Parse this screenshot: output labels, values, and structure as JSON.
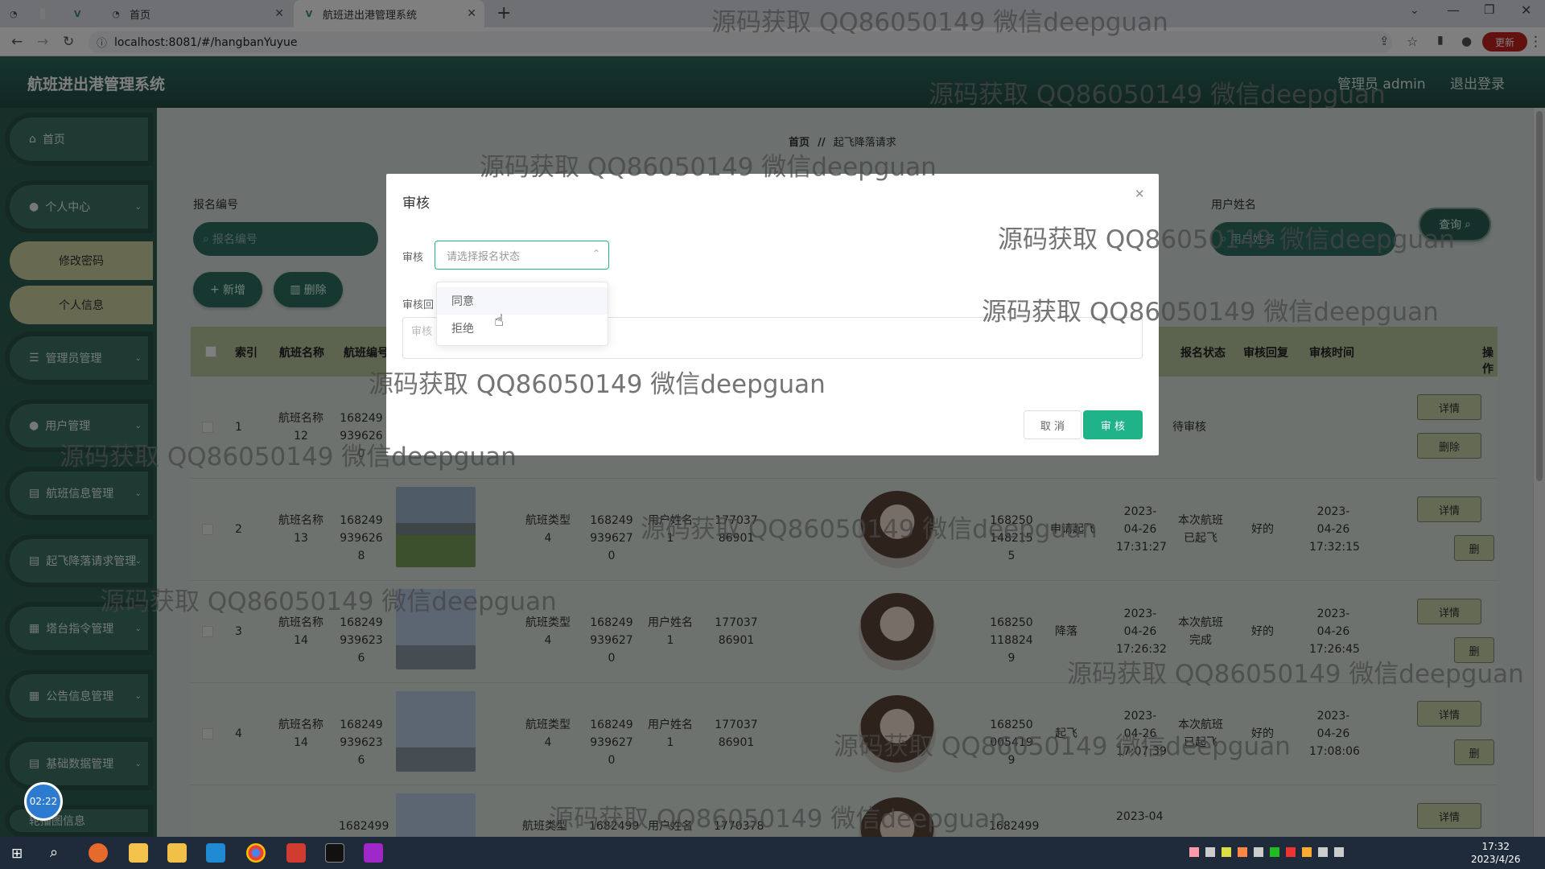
{
  "browser": {
    "tabs": [
      {
        "label": ""
      },
      {
        "label": ""
      },
      {
        "label": "首页"
      },
      {
        "label": "航班进出港管理系统"
      }
    ],
    "url": "localhost:8081/#/hangbanYuyue",
    "update_label": "更新"
  },
  "header": {
    "title": "航班进出港管理系统",
    "user": "管理员 admin",
    "logout": "退出登录"
  },
  "sidebar": {
    "items": [
      {
        "label": "首页"
      },
      {
        "label": "个人中心"
      },
      {
        "label": "修改密码"
      },
      {
        "label": "个人信息"
      },
      {
        "label": "管理员管理"
      },
      {
        "label": "用户管理"
      },
      {
        "label": "航班信息管理"
      },
      {
        "label": "起飞降落请求管理"
      },
      {
        "label": "塔台指令管理"
      },
      {
        "label": "公告信息管理"
      },
      {
        "label": "基础数据管理"
      },
      {
        "label": "轮播图信息"
      }
    ]
  },
  "breadcrumb": {
    "home": "首页",
    "sep": "//",
    "current": "起飞降落请求"
  },
  "search": {
    "label1": "报名编号",
    "placeholder1": "报名编号",
    "label2": "用户姓名",
    "placeholder2": "用户姓名",
    "query": "查询"
  },
  "toolbar": {
    "add": "新增",
    "delete": "删除"
  },
  "table": {
    "headers": [
      "索引",
      "航班名称",
      "航班编号",
      "",
      "",
      "",
      "",
      "",
      "",
      "报名状态",
      "审核回复",
      "审核时间",
      "操作"
    ],
    "rows": [
      {
        "index": "1",
        "name": "航班名称12",
        "code": "1682499396260",
        "h": "",
        "uid": "",
        "uname": "",
        "phone": "",
        "hid": "",
        "type": "",
        "status": "待审核",
        "reply": "",
        "time": ""
      },
      {
        "index": "2",
        "name": "航班名称13",
        "code": "1682499396268",
        "type1": "航班类型4",
        "n1": "1682499396270",
        "uname": "用户姓名1",
        "phone": "17703786901",
        "rid": "1682501482155",
        "req": "申请起飞",
        "status": "本次航班已起飞",
        "reply": "好的",
        "time": "2023-04-26 17:32:15",
        "rtime": "2023-04-26 17:31:27"
      },
      {
        "index": "3",
        "name": "航班名称14",
        "code": "1682499396236",
        "type1": "航班类型4",
        "n1": "1682499396270",
        "uname": "用户姓名1",
        "phone": "17703786901",
        "rid": "1682501188249",
        "req": "降落",
        "status": "本次航班完成",
        "reply": "好的",
        "time": "2023-04-26 17:26:45",
        "rtime": "2023-04-26 17:26:32"
      },
      {
        "index": "4",
        "name": "航班名称14",
        "code": "1682499396236",
        "type1": "航班类型4",
        "n1": "1682499396270",
        "uname": "用户姓名1",
        "phone": "17703786901",
        "rid": "1682500054199",
        "req": "起飞",
        "status": "本次航班已起飞",
        "reply": "好的",
        "time": "2023-04-26 17:08:06",
        "rtime": "2023-04-26 17:07:39"
      },
      {
        "index": "",
        "name": "",
        "code": "1682499",
        "type1": "航班类型",
        "n1": "1682499",
        "uname": "用户姓名",
        "phone": "1770378",
        "rid": "1682499",
        "req": "",
        "status": "",
        "reply": "",
        "time": "",
        "rtime": "2023-04"
      }
    ],
    "detail": "详情",
    "del": "删除",
    "del_short": "删"
  },
  "dialog": {
    "title": "审核",
    "field_label": "审核",
    "select_placeholder": "请选择报名状态",
    "options": [
      "同意",
      "拒绝"
    ],
    "reply_label": "审核回",
    "reply_placeholder": "审核",
    "cancel": "取 消",
    "confirm": "审 核"
  },
  "watermark": "源码获取 QQ86050149 微信deepguan",
  "timer": "02:22",
  "clock": {
    "time": "17:32",
    "date": "2023/4/26"
  },
  "colors": {
    "accent": "#20b38a",
    "sidebar": "#2d5e53",
    "header": "#214d44"
  }
}
